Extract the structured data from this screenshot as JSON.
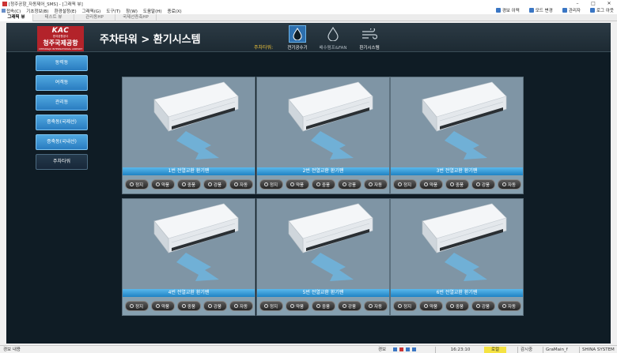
{
  "window": {
    "title": "[청주공항_자동제어_SMS] - [그래픽 뷰]",
    "controls": [
      "–",
      "□",
      "✕"
    ]
  },
  "menu": {
    "items": [
      "접속(C)",
      "기초정보(B)",
      "환경설정(E)",
      "그래픽(G)",
      "도구(T)",
      "창(W)",
      "도움말(H)",
      "종료(X)"
    ],
    "right_items": [
      {
        "label": "경보 이력",
        "color": "#3a76c4"
      },
      {
        "label": "모드 변경",
        "color": "#3a76c4"
      },
      {
        "label": "관리자",
        "color": "#3a76c4"
      },
      {
        "label": "로그 아웃",
        "color": "#3a76c4"
      }
    ]
  },
  "tabs": [
    "그래픽 뷰",
    "테스트 뷰",
    "관리동HP",
    "국제선증축HP"
  ],
  "header": {
    "logo": {
      "kac": "KAC",
      "sub": "한국공항공사",
      "name": "청주국제공항",
      "eng": "CHEONGJU INTERNATIONAL AIRPORT"
    },
    "title": "주차타워 > 환기시스템",
    "system_label": "주차타워:",
    "nav": [
      {
        "label": "전기공수기",
        "icon": "water-drop-icon",
        "active": true
      },
      {
        "label": "배수펌프&FAN",
        "icon": "pump-drop-icon",
        "active": false
      },
      {
        "label": "환기시스템",
        "icon": "wind-icon",
        "active": true
      }
    ]
  },
  "sidebar": {
    "items": [
      "동력동",
      "여객동",
      "관리동",
      "증축동(국제선)",
      "증축동(국내선)",
      "주차타워"
    ],
    "active_index": 5
  },
  "cards": [
    {
      "caption": "1번 전열교환 환기팬"
    },
    {
      "caption": "2번 전열교환 환기팬"
    },
    {
      "caption": "3번 전열교환 환기팬"
    },
    {
      "caption": "4번 전열교환 환기팬"
    },
    {
      "caption": "5번 전열교환 환기팬"
    },
    {
      "caption": "6번 전열교환 환기팬"
    }
  ],
  "card_buttons": [
    "정지",
    "약풍",
    "중풍",
    "강풍",
    "자동"
  ],
  "status": {
    "left": "경보 내용",
    "alarm": "경보",
    "time": "16:23:10",
    "mode": "로컬",
    "monitor": "감시중",
    "page": "GraMain_f",
    "company": "SHINA SYSTEM"
  },
  "colors": {
    "accent": "#2a7cc0",
    "header_yellow": "#f0c53a",
    "logo_red": "#b3232a",
    "panel_bg": "#0f1c25"
  }
}
